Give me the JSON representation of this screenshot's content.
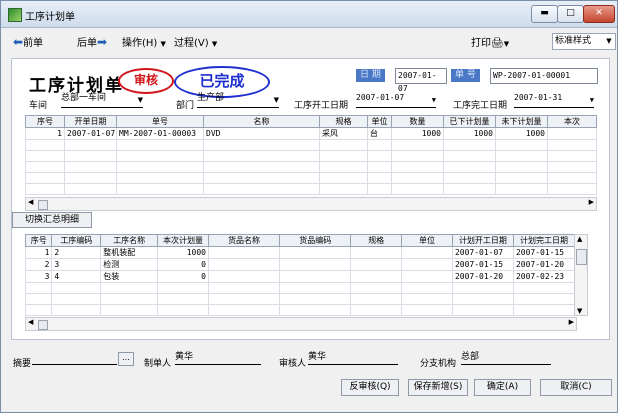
{
  "window": {
    "title": "工序计划单"
  },
  "toolbar": {
    "prev": "前单",
    "next": "后单",
    "ops": "操作(H)",
    "process": "过程(V)",
    "print": "打印",
    "format": "标准样式"
  },
  "header": {
    "doc_title": "工序计划单",
    "stamp_audit": "审核",
    "stamp_done": "已完成",
    "date_label": "日 期",
    "date_value": "2007-01-07",
    "number_label": "单 号",
    "number_value": "WP-2007-01-00001"
  },
  "fields": {
    "workshop_label": "车间",
    "workshop_value": "总部一车间",
    "dept_label": "部门",
    "dept_value": "生产部",
    "start_label": "工序开工日期",
    "start_value": "2007-01-07",
    "end_label": "工序完工日期",
    "end_value": "2007-01-31"
  },
  "main_grid": {
    "columns": [
      "序号",
      "开单日期",
      "单号",
      "名称",
      "规格",
      "单位",
      "数量",
      "已下计划量",
      "未下计划量",
      "本次"
    ],
    "rows": [
      [
        "1",
        "2007-01-07",
        "MM-2007-01-00003",
        "DVD",
        "采风",
        "台",
        "1000",
        "1000",
        "1000",
        ""
      ]
    ]
  },
  "switch_button": "切换汇总明细",
  "detail_grid": {
    "columns": [
      "序号",
      "工序编码",
      "工序名称",
      "本次计划量",
      "货品名称",
      "货品编码",
      "规格",
      "单位",
      "计划开工日期",
      "计划完工日期"
    ],
    "rows": [
      [
        "1",
        "2",
        "整机装配",
        "1000",
        "",
        "",
        "",
        "",
        "2007-01-07",
        "2007-01-15"
      ],
      [
        "2",
        "3",
        "检测",
        "0",
        "",
        "",
        "",
        "",
        "2007-01-15",
        "2007-01-20"
      ],
      [
        "3",
        "4",
        "包装",
        "0",
        "",
        "",
        "",
        "",
        "2007-01-20",
        "2007-02-23"
      ]
    ]
  },
  "footer": {
    "summary_label": "摘要",
    "ellipsis": "...",
    "maker_label": "制单人",
    "maker_value": "黄华",
    "auditor_label": "审核人",
    "auditor_value": "黄华",
    "branch_label": "分支机构",
    "branch_value": "总部"
  },
  "buttons": {
    "unaudit": "反审核(Q)",
    "save_new": "保存新增(S)",
    "confirm": "确定(A)",
    "cancel": "取消(C)"
  }
}
